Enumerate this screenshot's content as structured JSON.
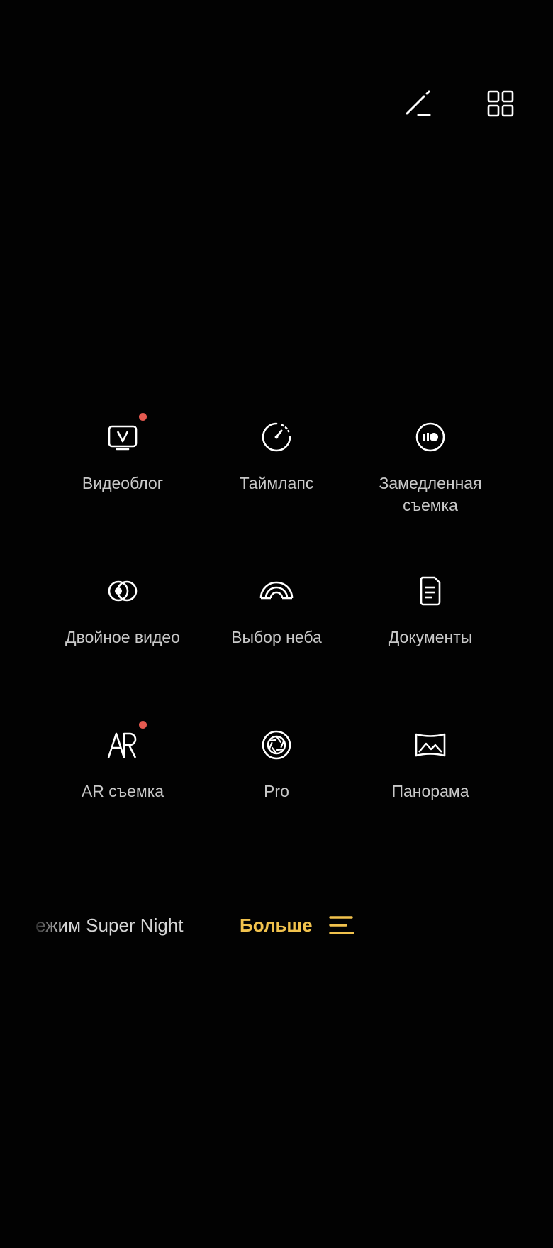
{
  "toolbar": {
    "edit_icon": "edit-icon",
    "grid_icon": "grid-icon"
  },
  "modes": [
    {
      "label": "Видеоблог",
      "icon": "vlog-icon",
      "new_badge": true
    },
    {
      "label": "Таймлапс",
      "icon": "timelapse-icon",
      "new_badge": false
    },
    {
      "label": "Замедленная съемка",
      "icon": "slow-motion-icon",
      "new_badge": false
    },
    {
      "label": "Двойное видео",
      "icon": "dual-video-icon",
      "new_badge": false
    },
    {
      "label": "Выбор неба",
      "icon": "sky-icon",
      "new_badge": false
    },
    {
      "label": "Документы",
      "icon": "document-icon",
      "new_badge": false
    },
    {
      "label": "AR съемка",
      "icon": "ar-icon",
      "new_badge": true
    },
    {
      "label": "Pro",
      "icon": "aperture-icon",
      "new_badge": false
    },
    {
      "label": "Панорама",
      "icon": "panorama-icon",
      "new_badge": false
    }
  ],
  "bottom": {
    "night_label": "ежим Super Night",
    "more_label": "Больше",
    "more_icon": "menu-lines-icon"
  },
  "colors": {
    "background": "#020202",
    "accent": "#f1c24d",
    "badge": "#e55a50",
    "label": "#c9c9c9"
  }
}
